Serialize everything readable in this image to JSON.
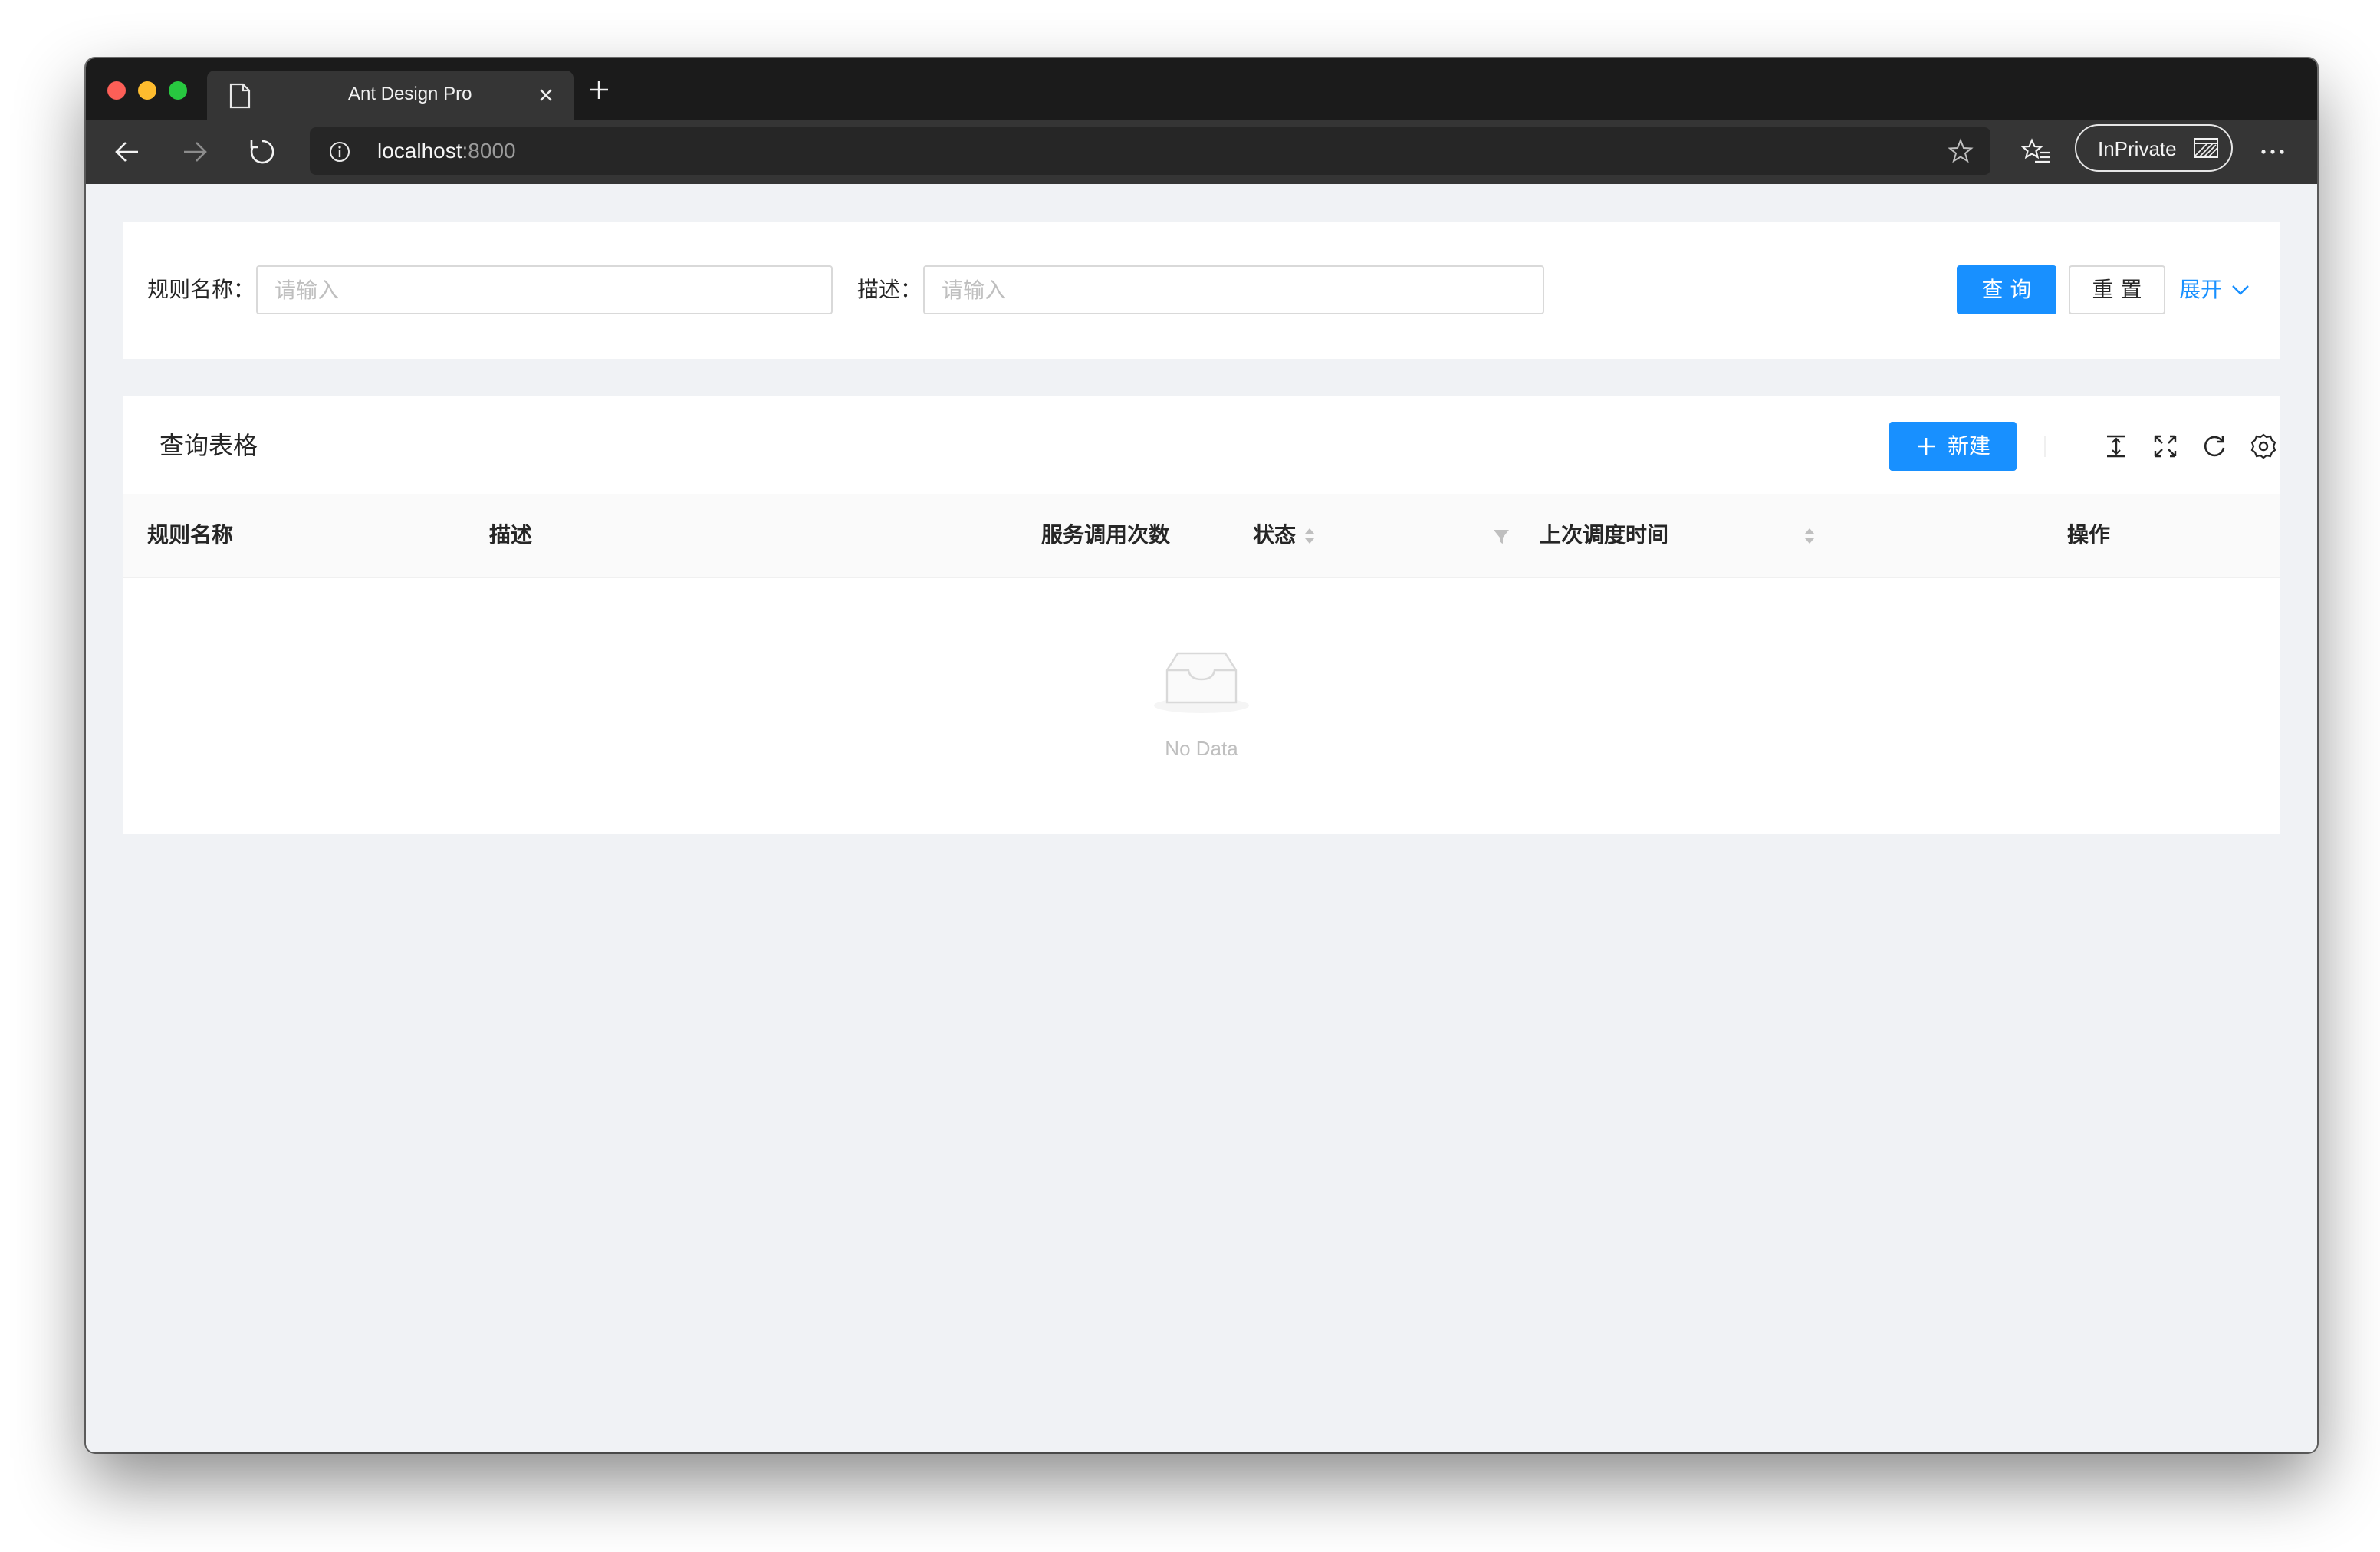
{
  "browser": {
    "tab_title": "Ant Design Pro",
    "url_host": "localhost",
    "url_port": ":8000",
    "inprivate_label": "InPrivate"
  },
  "search_form": {
    "rule_name_label": "规则名称：",
    "rule_name_placeholder": "请输入",
    "desc_label": "描述：",
    "desc_placeholder": "请输入",
    "query_button": "查 询",
    "reset_button": "重 置",
    "expand_link": "展开"
  },
  "table": {
    "title": "查询表格",
    "new_button": "新建",
    "columns": [
      "规则名称",
      "描述",
      "服务调用次数",
      "状态",
      "上次调度时间",
      "操作"
    ],
    "empty_text": "No Data"
  },
  "colors": {
    "primary": "#1890ff",
    "page_bg": "#f0f2f5"
  },
  "icons": [
    "page-icon",
    "close-icon",
    "plus-icon",
    "back-icon",
    "forward-icon",
    "refresh-icon",
    "info-icon",
    "star-icon",
    "favorites-icon",
    "inprivate-icon",
    "more-icon",
    "chevron-down-icon",
    "column-height-icon",
    "fullscreen-icon",
    "reload-icon",
    "setting-icon",
    "sort-icon",
    "filter-icon",
    "empty-inbox-icon"
  ]
}
